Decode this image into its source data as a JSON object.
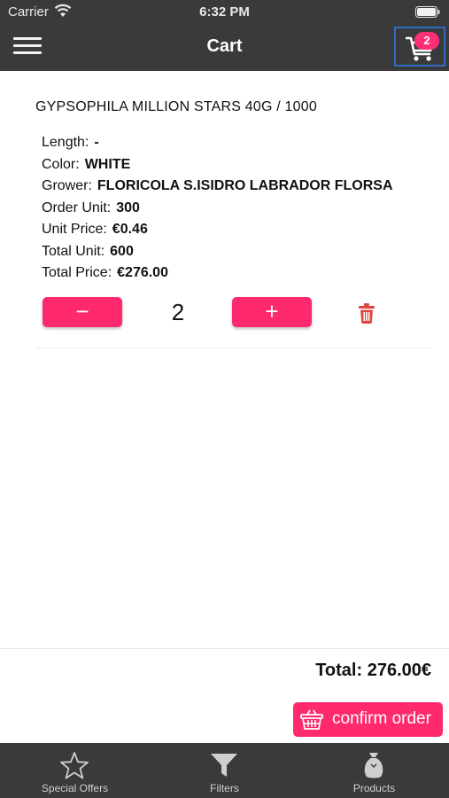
{
  "status_bar": {
    "carrier": "Carrier",
    "time": "6:32 PM"
  },
  "nav": {
    "title": "Cart",
    "cart_badge": "2",
    "menu_icon": "hamburger-icon",
    "cart_icon": "cart-icon"
  },
  "item": {
    "title": "GYPSOPHILA MILLION STARS 40G / 1000",
    "details": [
      {
        "label": "Length:",
        "value": "-"
      },
      {
        "label": "Color:",
        "value": "WHITE"
      },
      {
        "label": "Grower:",
        "value": "FLORICOLA S.ISIDRO LABRADOR FLORSA"
      },
      {
        "label": "Order Unit:",
        "value": "300"
      },
      {
        "label": "Unit Price:",
        "value": "€0.46"
      },
      {
        "label": "Total Unit:",
        "value": "600"
      },
      {
        "label": "Total Price:",
        "value": "€276.00"
      }
    ],
    "quantity": "2",
    "minus_label": "−",
    "plus_label": "+"
  },
  "footer": {
    "total": "Total: 276.00€",
    "confirm_label": "confirm order"
  },
  "tabs": [
    {
      "label": "Special Offers",
      "icon": "star-icon"
    },
    {
      "label": "Filters",
      "icon": "filter-icon"
    },
    {
      "label": "Products",
      "icon": "products-bag-icon"
    }
  ],
  "colors": {
    "accent": "#ff2a6d",
    "bar": "#3a3a3a",
    "delete": "#e0443e",
    "selection": "#2d6cc4"
  }
}
